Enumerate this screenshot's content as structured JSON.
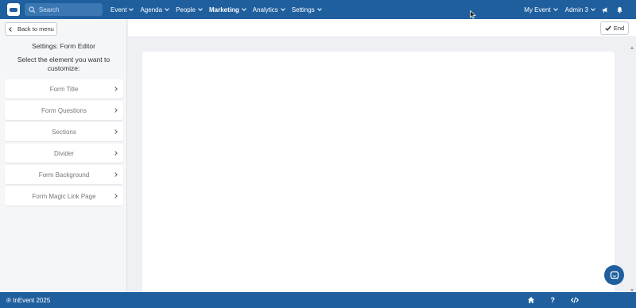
{
  "topbar": {
    "search_placeholder": "Search",
    "nav": [
      {
        "label": "Event",
        "bold": false
      },
      {
        "label": "Agenda",
        "bold": false
      },
      {
        "label": "People",
        "bold": false
      },
      {
        "label": "Marketing",
        "bold": true
      },
      {
        "label": "Analytics",
        "bold": false
      },
      {
        "label": "Settings",
        "bold": false
      }
    ],
    "event_selector": "My Event",
    "user_menu": "Admin 3",
    "icons": [
      "megaphone-icon",
      "bell-icon"
    ]
  },
  "sidebar": {
    "back_label": "Back to menu",
    "title": "Settings: Form Editor",
    "subtitle": "Select the element you want to customize:",
    "items": [
      {
        "label": "Form Title"
      },
      {
        "label": "Form Questions"
      },
      {
        "label": "Sections"
      },
      {
        "label": "Divider"
      },
      {
        "label": "Form Background"
      },
      {
        "label": "Form Magic Link Page"
      }
    ]
  },
  "main": {
    "end_label": "End"
  },
  "footer": {
    "copyright": "® InEvent 2025",
    "icons": [
      "home-icon",
      "help-icon",
      "code-icon"
    ],
    "help_glyph": "?"
  },
  "colors": {
    "brand": "#1f5f9e",
    "background": "#eef0f3",
    "panel": "#ffffff"
  }
}
